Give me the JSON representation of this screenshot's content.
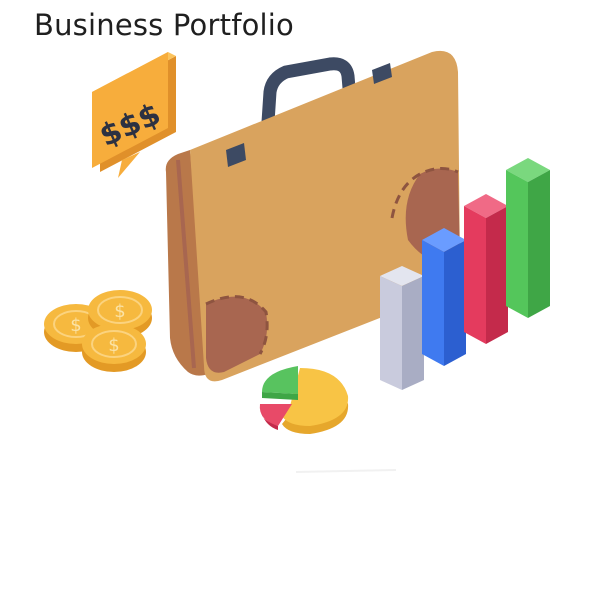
{
  "header": {
    "title": "Business Portfolio"
  },
  "speech_bubble": {
    "text": "$$$"
  },
  "icons": [
    "briefcase-icon",
    "speech-bubble-icon",
    "coin-icon",
    "bar-chart-icon",
    "pie-chart-icon"
  ],
  "colors": {
    "briefcase_body": "#d9a35e",
    "briefcase_side": "#b9784a",
    "briefcase_corner": "#a86650",
    "handle": "#3d4a63",
    "bubble": "#f7ad3c",
    "coin": "#f6b93f",
    "bar_gray": "#c9cbdd",
    "bar_blue": "#3f7af0",
    "bar_red": "#e43b5e",
    "bar_green": "#54c65b",
    "pie_yellow": "#f8c445",
    "pie_green": "#58c35f",
    "pie_red": "#e84a68"
  }
}
